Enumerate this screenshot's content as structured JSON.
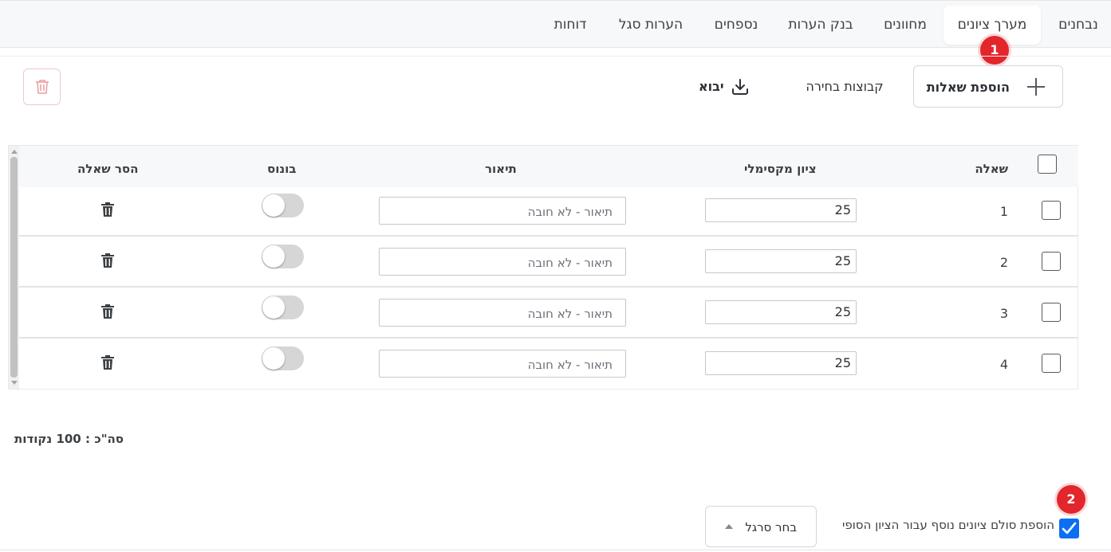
{
  "tabs": [
    {
      "label": "נבחנים",
      "active": false
    },
    {
      "label": "מערך ציונים",
      "active": true
    },
    {
      "label": "מחוונים",
      "active": false
    },
    {
      "label": "בנק הערות",
      "active": false
    },
    {
      "label": "נספחים",
      "active": false
    },
    {
      "label": "הערות סגל",
      "active": false
    },
    {
      "label": "דוחות",
      "active": false
    }
  ],
  "badges": {
    "first": "1",
    "second": "2"
  },
  "toolbar": {
    "add_questions_label": "הוספת שאלות",
    "choice_groups_label": "קבוצות בחירה",
    "import_label": "יבוא"
  },
  "table": {
    "headers": {
      "question": "שאלה",
      "max_score": "ציון מקסימלי",
      "description": "תיאור",
      "bonus": "בונוס",
      "remove": "הסר שאלה"
    },
    "description_placeholder": "תיאור - לא חובה",
    "rows": [
      {
        "number": "1",
        "max_score": "25",
        "bonus": false,
        "checked": false
      },
      {
        "number": "2",
        "max_score": "25",
        "bonus": false,
        "checked": false
      },
      {
        "number": "3",
        "max_score": "25",
        "bonus": false,
        "checked": false
      },
      {
        "number": "4",
        "max_score": "25",
        "bonus": false,
        "checked": false
      }
    ]
  },
  "total_label": "סה\"כ : 100 נקודות",
  "bonus_scale": {
    "checkbox_label": "הוספת סולם ציונים נוסף עבור הציון הסופי",
    "checked": true,
    "ruler_select_label": "בחר סרגל"
  },
  "colors": {
    "badge": "#e3262c",
    "checkbox_checked": "#0b6ff2",
    "delete_outline": "#f2c7c9"
  }
}
